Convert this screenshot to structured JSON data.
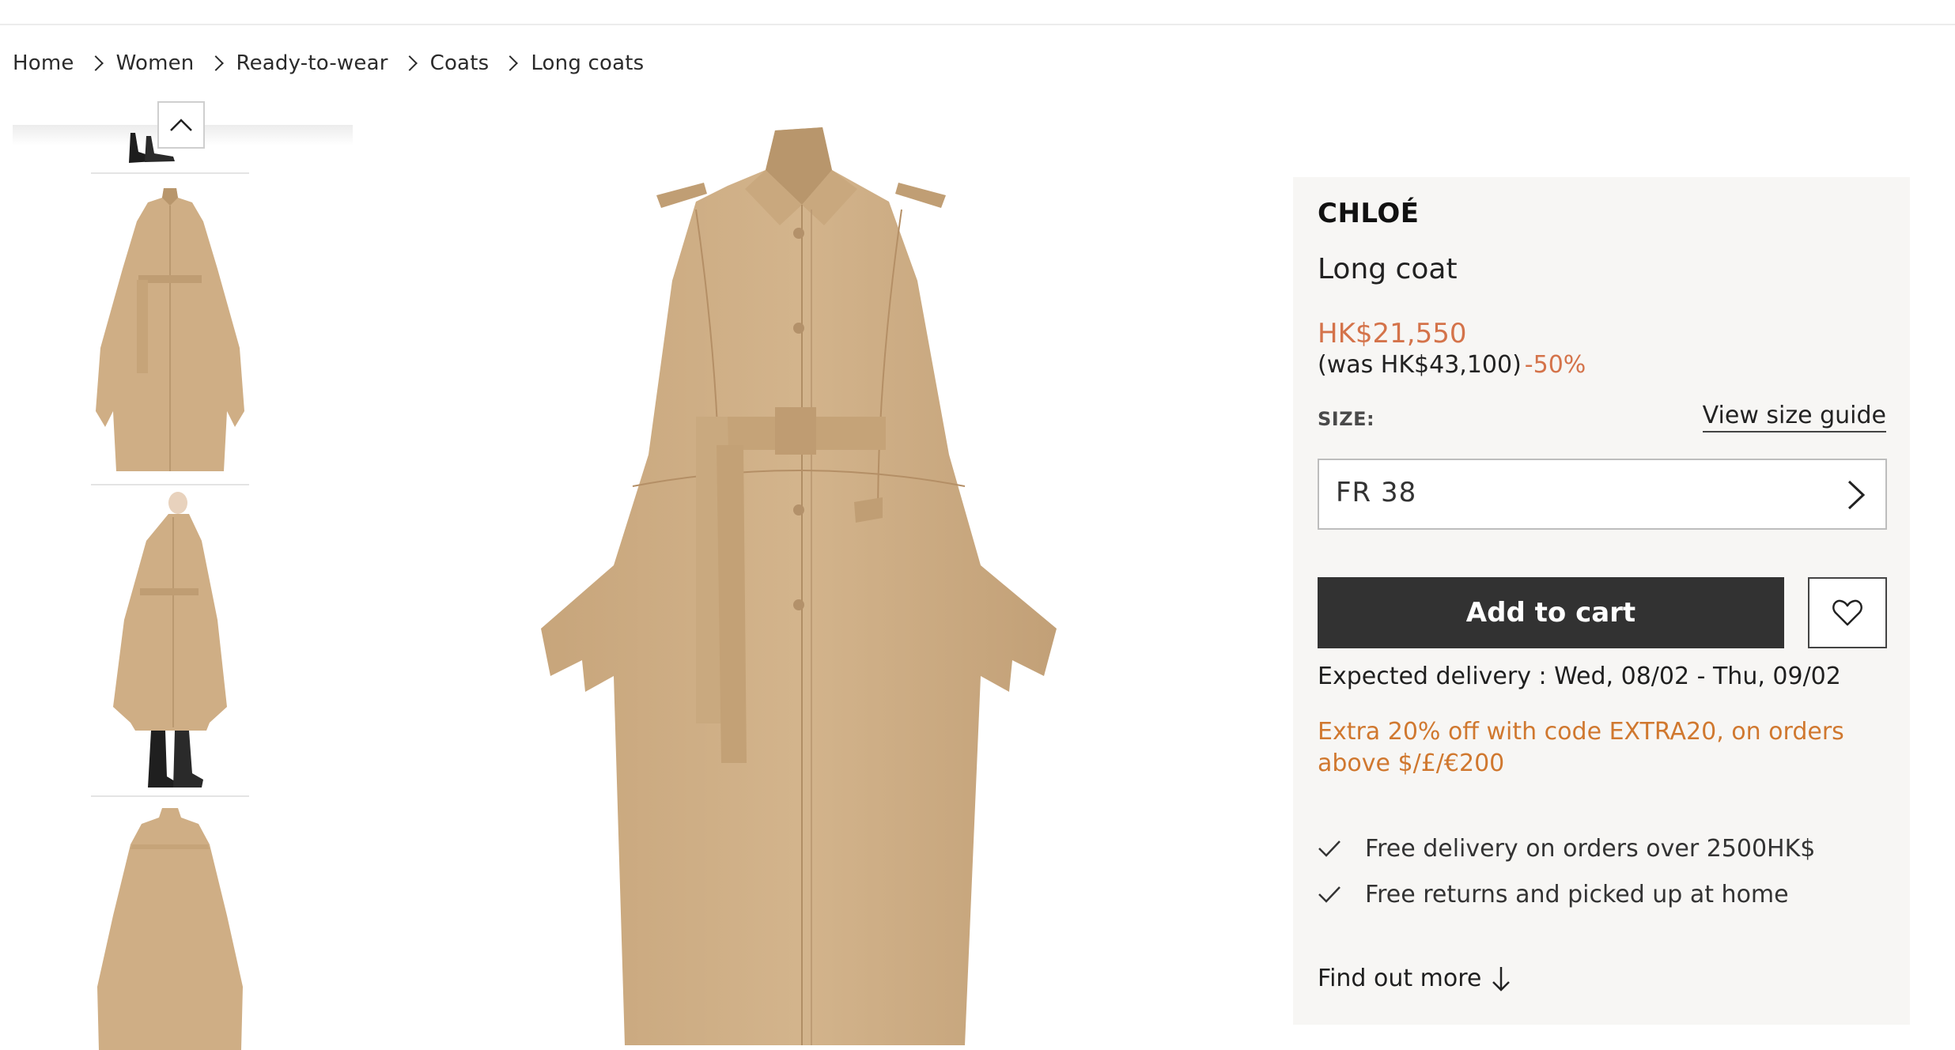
{
  "breadcrumb": [
    "Home",
    "Women",
    "Ready-to-wear",
    "Coats",
    "Long coats"
  ],
  "thumbnails": [
    {
      "name": "thumbnail-boots-partial"
    },
    {
      "name": "thumbnail-front-view"
    },
    {
      "name": "thumbnail-side-model"
    },
    {
      "name": "thumbnail-back-view"
    }
  ],
  "product": {
    "brand": "CHLOÉ",
    "name": "Long coat",
    "price": "HK$21,550",
    "was_price": "(was HK$43,100)",
    "discount": "-50%",
    "size_label": "SIZE:",
    "size_guide": "View size guide",
    "selected_size": "FR 38",
    "add_to_cart": "Add to cart",
    "delivery": "Expected delivery : Wed, 08/02 - Thu, 09/02",
    "promo": "Extra 20% off with code EXTRA20, on orders above $/£/€200",
    "perks": [
      "Free delivery on orders over 2500HK$",
      "Free returns and picked up at home"
    ],
    "find_out_more": "Find out more"
  },
  "colors": {
    "accent_price": "#d4734a",
    "promo": "#d0782f",
    "cart_button": "#323232",
    "panel_bg": "#f7f6f4",
    "coat": "#cfae85"
  },
  "icons": [
    "chevron-right-icon",
    "chevron-up-icon",
    "heart-icon",
    "check-icon",
    "arrow-down-icon"
  ]
}
